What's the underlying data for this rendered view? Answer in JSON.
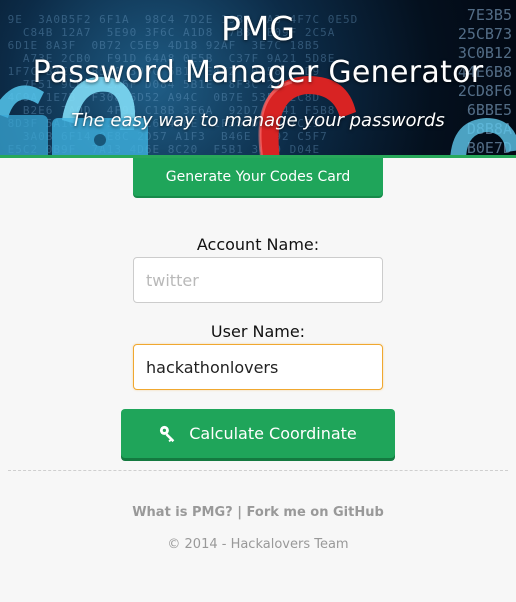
{
  "header": {
    "title": "PMG",
    "subtitle": "Password Manager Generator",
    "tagline": "The easy way to manage your passwords"
  },
  "generate_button": {
    "label": "Generate Your Codes Card"
  },
  "form": {
    "account": {
      "label": "Account Name:",
      "placeholder": "twitter",
      "value": ""
    },
    "user": {
      "label": "User Name:",
      "placeholder": "",
      "value": "hackathonlovers"
    }
  },
  "calculate_button": {
    "label": "Calculate Coordinate",
    "icon": "key-icon"
  },
  "footer": {
    "what_is_link": "What is PMG?",
    "separator": "|",
    "github_link": "Fork me on GitHub",
    "copyright": "© 2014 - Hackalovers Team"
  },
  "colors": {
    "accent_green": "#1fa55a",
    "focus_orange": "#f0a830",
    "banner_dark": "#04101e"
  }
}
